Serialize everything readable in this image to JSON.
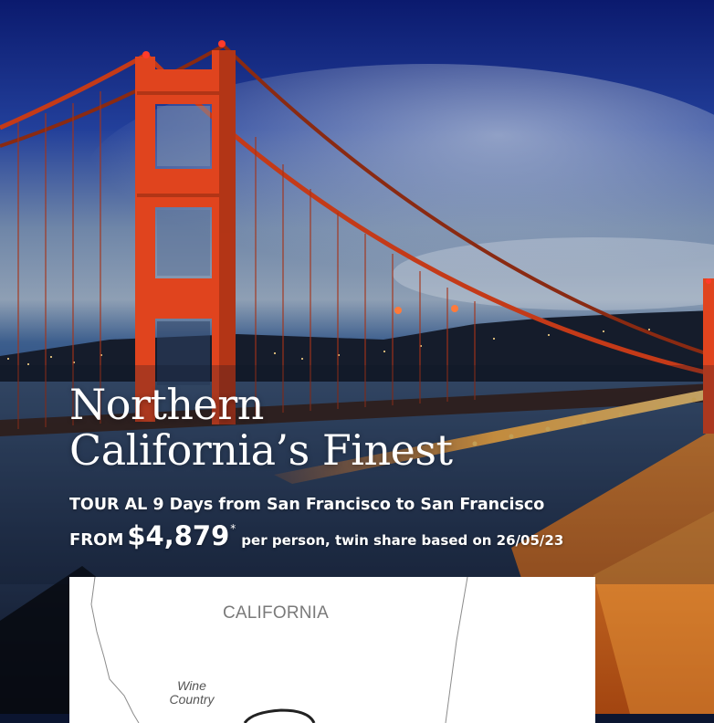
{
  "hero": {
    "title_line1": "Northern",
    "title_line2": "California’s Finest",
    "tour_line": "TOUR AL 9 Days from San Francisco to San Francisco",
    "price_from": "FROM",
    "price_amount": "$4,879",
    "price_marker": "*",
    "price_note": "per person, twin share based on 26/05/23"
  },
  "map": {
    "state_label": "CALIFORNIA",
    "region_label_line1": "Wine",
    "region_label_line2": "Country"
  },
  "colors": {
    "sky_top": "#0b1a6e",
    "bridge_red": "#e0441e",
    "water": "#2a3f66",
    "road_light": "#ffb347",
    "text": "#ffffff"
  }
}
